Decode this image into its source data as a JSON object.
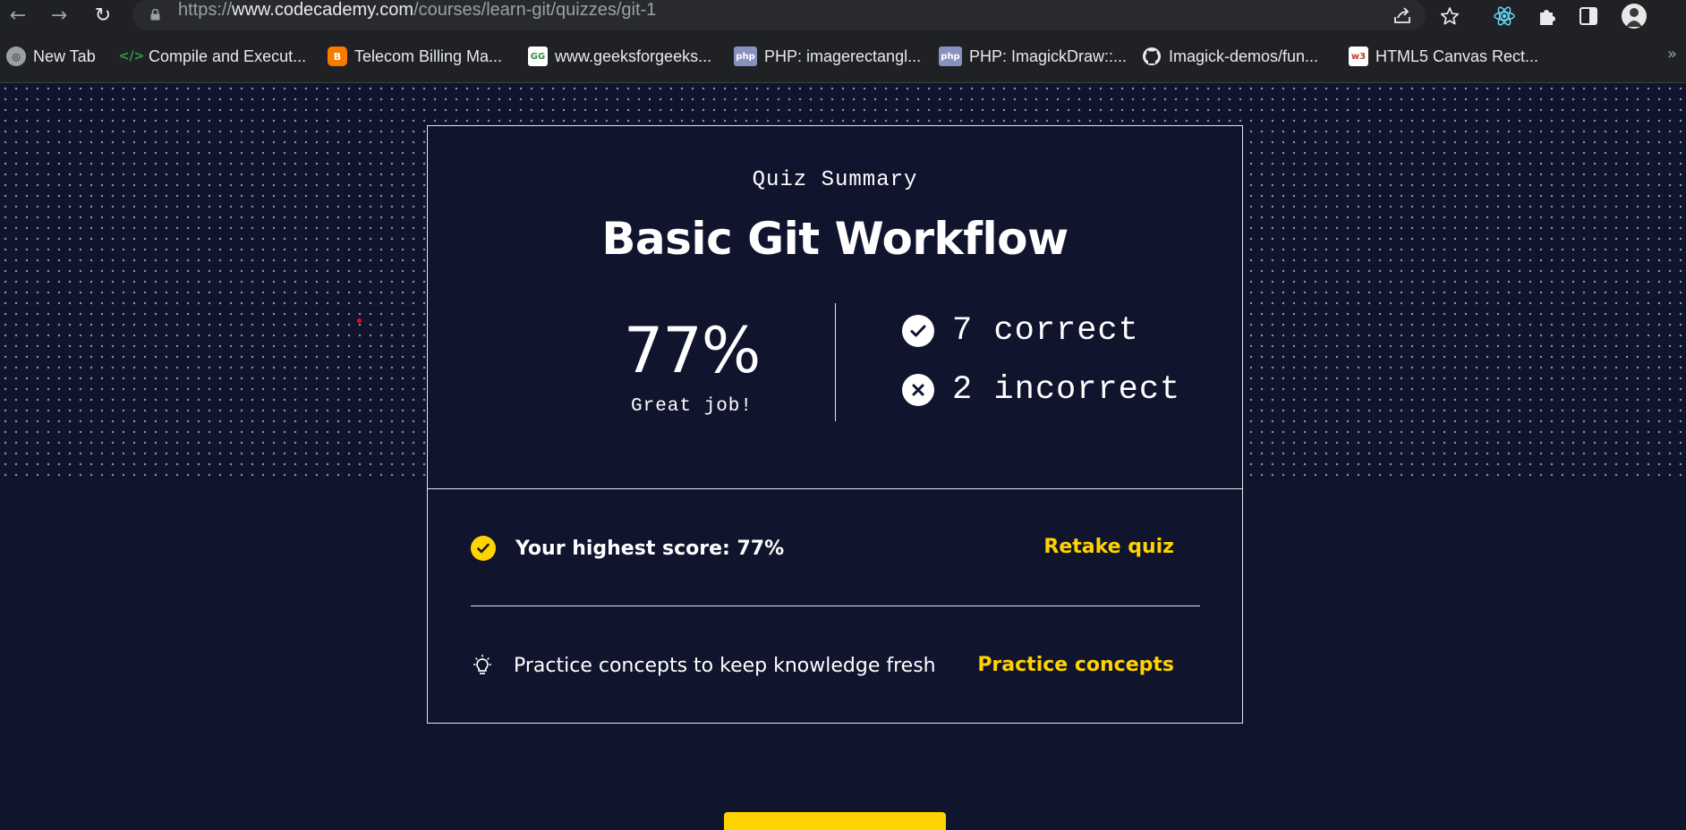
{
  "browser": {
    "url_prefix": "https://",
    "url_host": "www.codecademy.com",
    "url_path": "/courses/learn-git/quizzes/git-1",
    "nav": {
      "back": "←",
      "forward": "→",
      "reload": "↻"
    },
    "bookmarks": [
      {
        "label": "New Tab",
        "icon": "globe-icon"
      },
      {
        "label": "Compile and Execut...",
        "icon": "code-icon"
      },
      {
        "label": "Telecom Billing Ma...",
        "icon": "blogger-icon"
      },
      {
        "label": "www.geeksforgeeks...",
        "icon": "gfg-icon"
      },
      {
        "label": "PHP: imagerectangl...",
        "icon": "php-icon"
      },
      {
        "label": "PHP: ImagickDraw::...",
        "icon": "php-icon"
      },
      {
        "label": "Imagick-demos/fun...",
        "icon": "github-icon"
      },
      {
        "label": "HTML5 Canvas Rect...",
        "icon": "w3schools-icon"
      }
    ],
    "bookmarks_overflow": "»",
    "favicon_text": {
      "gfg": "GG",
      "php": "php",
      "w3": "w3"
    }
  },
  "quiz": {
    "eyebrow": "Quiz Summary",
    "title": "Basic Git Workflow",
    "score_percent": "77%",
    "score_message": "Great job!",
    "correct_label": "7 correct",
    "incorrect_label": "2 incorrect",
    "highest_score_label": "Your highest score: 77%",
    "retake_label": "Retake quiz",
    "practice_text": "Practice concepts to keep knowledge fresh",
    "practice_label": "Practice concepts"
  },
  "colors": {
    "background": "#10142d",
    "accent": "#ffd300",
    "text": "#ffffff"
  }
}
